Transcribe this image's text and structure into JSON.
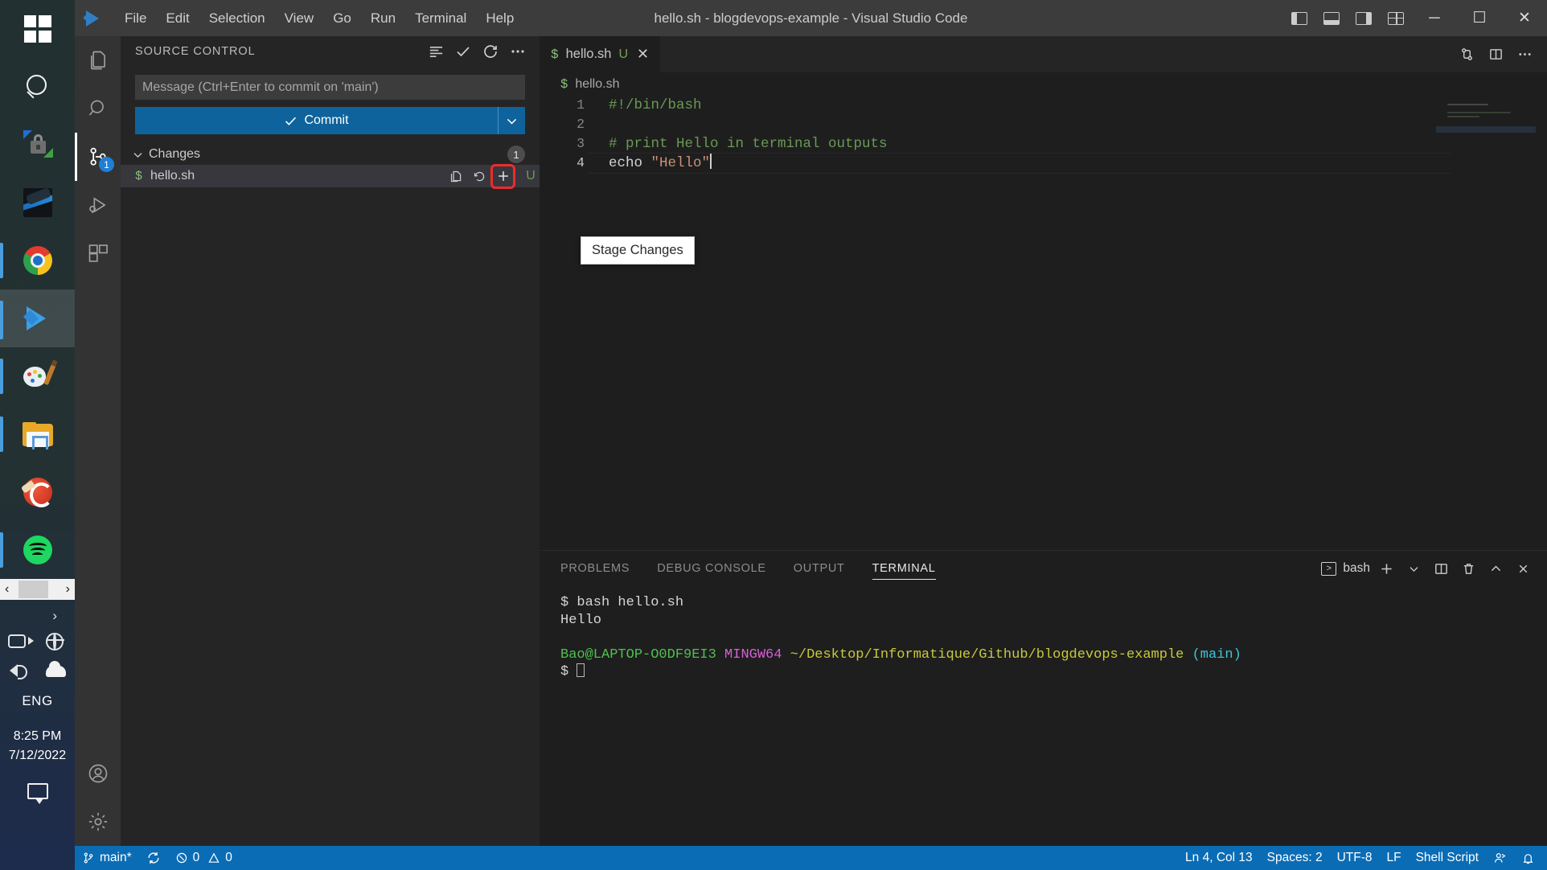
{
  "taskbar": {
    "items": [
      {
        "name": "start-button",
        "label": "Start"
      },
      {
        "name": "search-button",
        "label": "Search"
      },
      {
        "name": "sync-lock-app",
        "label": "Sync Lock"
      },
      {
        "name": "wallpaper-app",
        "label": "Wallpaper Engine"
      },
      {
        "name": "chrome-app",
        "label": "Google Chrome"
      },
      {
        "name": "vscode-app",
        "label": "Visual Studio Code"
      },
      {
        "name": "paint-app",
        "label": "Paint"
      },
      {
        "name": "file-explorer-app",
        "label": "File Explorer"
      },
      {
        "name": "ccleaner-app",
        "label": "CCleaner"
      },
      {
        "name": "spotify-app",
        "label": "Spotify"
      }
    ],
    "scroll_left": "‹",
    "scroll_right": "›",
    "tray": {
      "overflow": "›",
      "language": "ENG",
      "time": "8:25 PM",
      "date": "7/12/2022"
    }
  },
  "titlebar": {
    "menu": [
      "File",
      "Edit",
      "Selection",
      "View",
      "Go",
      "Run",
      "Terminal",
      "Help"
    ],
    "title": "hello.sh - blogdevops-example - Visual Studio Code",
    "window_controls": {
      "minimize": "─",
      "maximize": "☐",
      "close": "✕"
    }
  },
  "activitybar": {
    "items": [
      {
        "name": "explorer",
        "label": "Explorer",
        "badge": ""
      },
      {
        "name": "search",
        "label": "Search",
        "badge": ""
      },
      {
        "name": "source-control",
        "label": "Source Control",
        "badge": "1",
        "active": true
      },
      {
        "name": "run-debug",
        "label": "Run and Debug",
        "badge": ""
      },
      {
        "name": "extensions",
        "label": "Extensions",
        "badge": ""
      }
    ],
    "bottom": [
      {
        "name": "accounts",
        "label": "Accounts"
      },
      {
        "name": "manage",
        "label": "Manage"
      }
    ]
  },
  "sidebar": {
    "title": "SOURCE CONTROL",
    "commit_input_placeholder": "Message (Ctrl+Enter to commit on 'main')",
    "commit_input_value": "",
    "commit_button_label": "Commit",
    "changes_group_label": "Changes",
    "changes_count": "1",
    "files": [
      {
        "symbol": "$",
        "name": "hello.sh",
        "status": "U",
        "actions": [
          "open-file",
          "discard-changes",
          "stage-changes"
        ]
      }
    ],
    "tooltip": "Stage Changes"
  },
  "editor": {
    "tab": {
      "symbol": "$",
      "name": "hello.sh",
      "status": "U",
      "close": "✕"
    },
    "breadcrumb": {
      "symbol": "$",
      "name": "hello.sh"
    },
    "lines": [
      {
        "num": "1",
        "text": "#!/bin/bash",
        "type": "comment"
      },
      {
        "num": "2",
        "text": "",
        "type": "plain"
      },
      {
        "num": "3",
        "text": "# print Hello in terminal outputs",
        "type": "comment"
      },
      {
        "num": "4",
        "text": "echo ",
        "type": "code",
        "string": "\"Hello\"",
        "current": true
      }
    ]
  },
  "panel": {
    "tabs": [
      {
        "label": "PROBLEMS",
        "active": false
      },
      {
        "label": "DEBUG CONSOLE",
        "active": false
      },
      {
        "label": "OUTPUT",
        "active": false
      },
      {
        "label": "TERMINAL",
        "active": true
      }
    ],
    "shell_name": "bash",
    "terminal": {
      "command_prompt": "$ ",
      "command": "bash hello.sh",
      "output": "Hello",
      "user_host": "Bao@LAPTOP-O0DF9EI3",
      "shell_env": "MINGW64",
      "path": "~/Desktop/Informatique/Github/blogdevops-example",
      "branch": "(main)",
      "prompt": "$ "
    }
  },
  "statusbar": {
    "branch": "main*",
    "errors": "0",
    "warnings": "0",
    "cursor": "Ln 4, Col 13",
    "indent": "Spaces: 2",
    "encoding": "UTF-8",
    "eol": "LF",
    "language": "Shell Script"
  },
  "colors": {
    "accent": "#0a6cb5",
    "commit_button": "#0e639c",
    "highlight_outline": "#ef2b2b",
    "untracked": "#6a9955",
    "titlebar": "#3c3c3c",
    "sidebar": "#252526",
    "editor": "#1e1e1e"
  }
}
